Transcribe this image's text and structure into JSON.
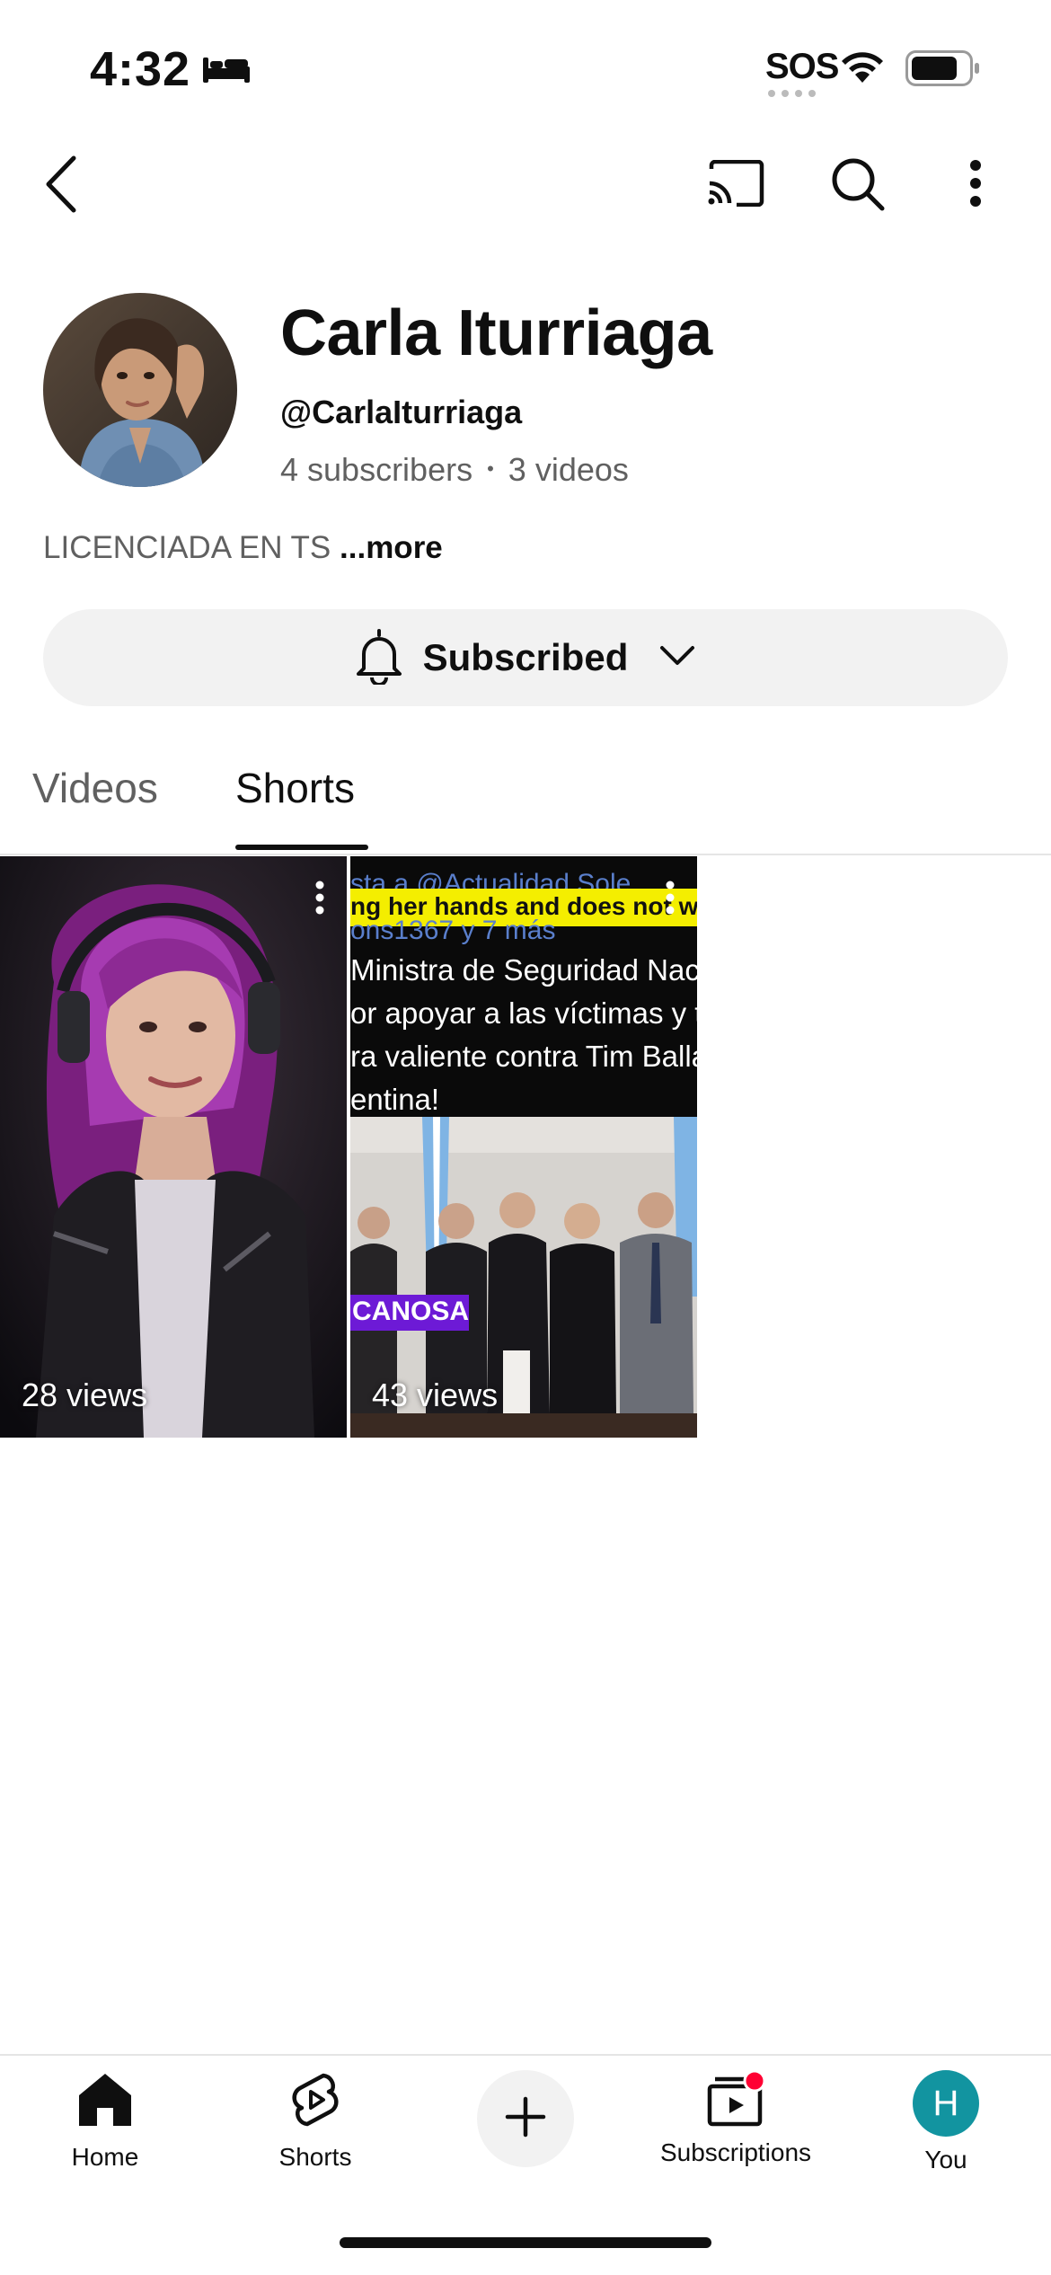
{
  "status_bar": {
    "time": "4:32",
    "sos": "SOS",
    "focus_icon": "bed-icon"
  },
  "top_bar": {
    "icons": [
      "back-chevron-icon",
      "cast-icon",
      "search-icon",
      "more-vert-icon"
    ]
  },
  "channel": {
    "name": "Carla Iturriaga",
    "handle": "@CarlaIturriaga",
    "subscribers": "4 subscribers",
    "videos": "3 videos",
    "separator": "•",
    "description": "LICENCIADA EN TS",
    "more_label": "...more"
  },
  "subscribe_button": {
    "label": "Subscribed"
  },
  "tabs": [
    {
      "label": "Videos",
      "selected": false
    },
    {
      "label": "Shorts",
      "selected": true
    }
  ],
  "shorts": [
    {
      "views": "28 views"
    },
    {
      "views": "43 views",
      "overlay_lines": {
        "faint_top": "sta a @Actualidad Sole",
        "caption": "ng her hands and does not wan",
        "faint_mention": "ons1367 y 7 más",
        "text1": "Ministra de Seguridad Nacio",
        "text2": "or apoyar a las víctimas y to",
        "text3": "ra valiente contra Tim Balla",
        "text4": "entina!",
        "badge": "CANOSA"
      }
    }
  ],
  "bottom_nav": {
    "items": [
      {
        "label": "Home"
      },
      {
        "label": "Shorts"
      },
      {
        "label": ""
      },
      {
        "label": "Subscriptions"
      },
      {
        "label": "You",
        "avatar_letter": "H"
      }
    ]
  },
  "colors": {
    "accent_avatar": "#1294a0",
    "notification_dot": "#ff0033",
    "caption_highlight": "#f4ee00"
  }
}
